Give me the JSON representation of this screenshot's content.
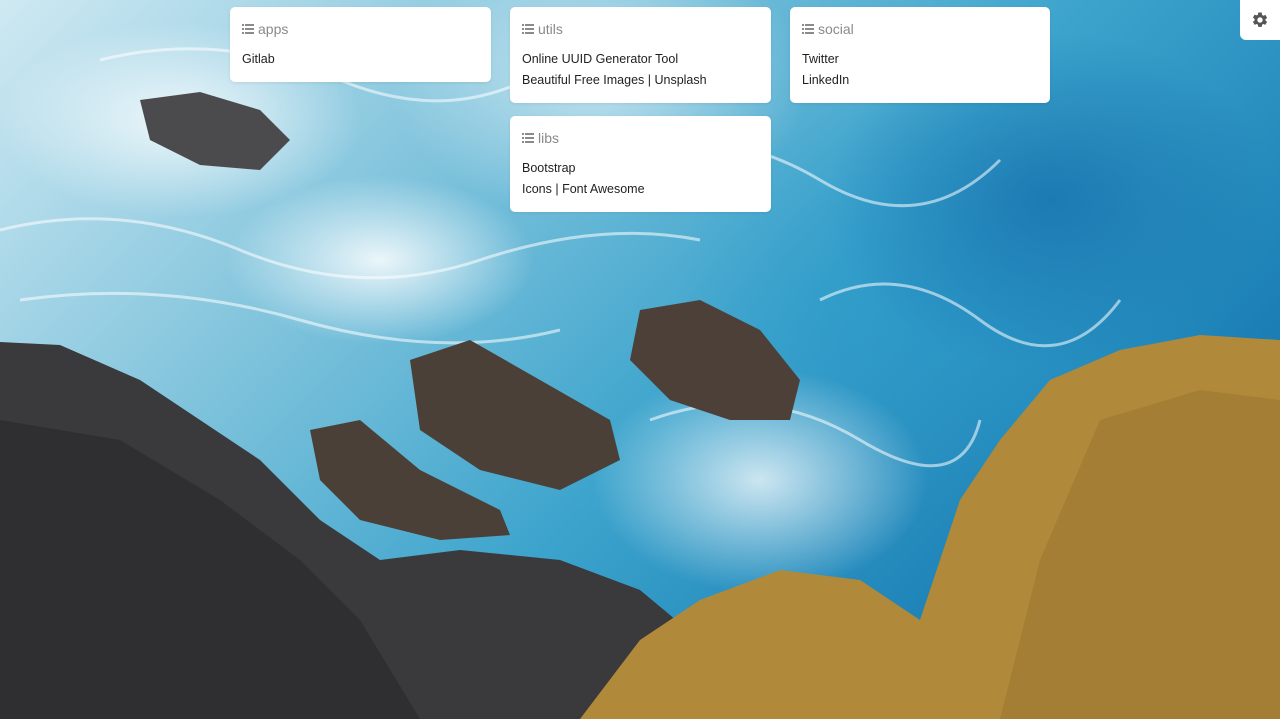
{
  "cards": {
    "apps": {
      "title": "apps",
      "links": [
        "Gitlab"
      ]
    },
    "utils": {
      "title": "utils",
      "links": [
        "Online UUID Generator Tool",
        "Beautiful Free Images | Unsplash"
      ]
    },
    "social": {
      "title": "social",
      "links": [
        "Twitter",
        "LinkedIn"
      ]
    },
    "libs": {
      "title": "libs",
      "links": [
        "Bootstrap",
        "Icons | Font Awesome"
      ]
    }
  },
  "icons": {
    "card_header": "list-icon",
    "settings": "gear-icon"
  },
  "colors": {
    "card_background": "#ffffff",
    "header_text": "#8a8a8a",
    "link_text": "#1f1f1f",
    "settings_icon": "#555555"
  }
}
